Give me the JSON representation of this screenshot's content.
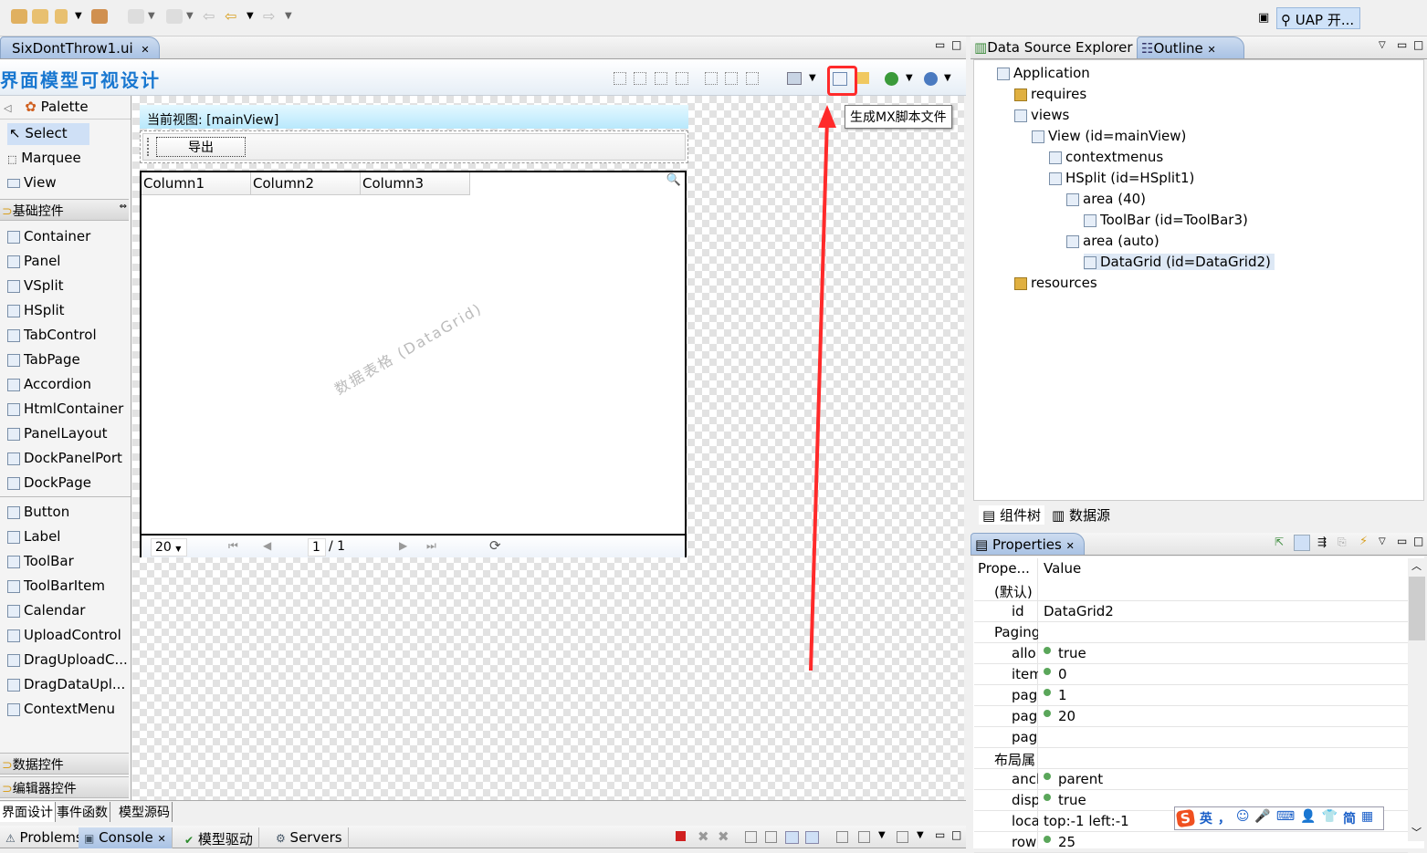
{
  "top_toolbar": {
    "icons": [
      "open-project-icon",
      "open-folder-icon",
      "build-icon",
      "open-archive-icon",
      "step-down-icon",
      "step-up-icon",
      "back-disabled-icon",
      "back-icon",
      "forward-icon"
    ],
    "perspective_label": "UAP 开..."
  },
  "editor": {
    "tab_label": "SixDontThrow1.ui",
    "title": "界面模型可视设计",
    "tooltip": "生成MX脚本文件",
    "highlight_color": "#ff2a2a",
    "bottom_tabs": [
      "界面设计",
      "事件函数",
      "模型源码"
    ]
  },
  "palette": {
    "header": "Palette",
    "tools": [
      "Select",
      "Marquee",
      "View"
    ],
    "category_basic": "基础控件",
    "basic_items": [
      "Container",
      "Panel",
      "VSplit",
      "HSplit",
      "TabControl",
      "TabPage",
      "Accordion",
      "HtmlContainer",
      "PanelLayout",
      "DockPanelPort",
      "DockPage"
    ],
    "other_items": [
      "Button",
      "Label",
      "ToolBar",
      "ToolBarItem",
      "Calendar",
      "UploadControl",
      "DragUploadC...",
      "DragDataUpl...",
      "ContextMenu"
    ],
    "category_data": "数据控件",
    "category_editor": "编辑器控件"
  },
  "canvas": {
    "view_label": "当前视图:  [mainView]",
    "export_button": "导出",
    "columns": [
      "Column1",
      "Column2",
      "Column3"
    ],
    "watermark": "数据表格 (DataGrid)",
    "pager": {
      "page_size": "20",
      "current_page": "1",
      "total": "/ 1"
    }
  },
  "outline": {
    "tabs": [
      "Data Source Explorer",
      "Outline"
    ],
    "tree": [
      "Application",
      "requires",
      "views",
      "View (id=mainView)",
      "contextmenus",
      "HSplit (id=HSplit1)",
      "area (40)",
      "ToolBar (id=ToolBar3)",
      "area (auto)",
      "DataGrid (id=DataGrid2)",
      "resources"
    ],
    "bottom_tabs": [
      "组件树",
      "数据源"
    ]
  },
  "properties": {
    "title": "Properties",
    "col_property": "Prope...",
    "col_value": "Value",
    "rows": [
      {
        "k": "(默认)",
        "v": "",
        "cat": true
      },
      {
        "k": "id",
        "v": "DataGrid2"
      },
      {
        "k": "Paging",
        "v": "",
        "cat": true
      },
      {
        "k": "allo",
        "v": "true",
        "dot": true
      },
      {
        "k": "item",
        "v": "0",
        "dot": true
      },
      {
        "k": "pag",
        "v": "1",
        "dot": true
      },
      {
        "k": "pag",
        "v": "20",
        "dot": true
      },
      {
        "k": "pag",
        "v": ""
      },
      {
        "k": "布局属",
        "v": "",
        "cat": true
      },
      {
        "k": "ancl",
        "v": "parent",
        "dot": true
      },
      {
        "k": "disp",
        "v": "true",
        "dot": true
      },
      {
        "k": "loca",
        "v": "top:-1 left:-1"
      },
      {
        "k": "row",
        "v": "25",
        "dot": true
      }
    ]
  },
  "ime_bar": {
    "items": [
      "英",
      "，",
      "☺",
      "🎤",
      "⌨",
      "👤",
      "👕",
      "简",
      "▦"
    ]
  },
  "bottom_panel": {
    "tabs": [
      "Problems",
      "Console",
      "模型驱动",
      "Servers"
    ]
  }
}
